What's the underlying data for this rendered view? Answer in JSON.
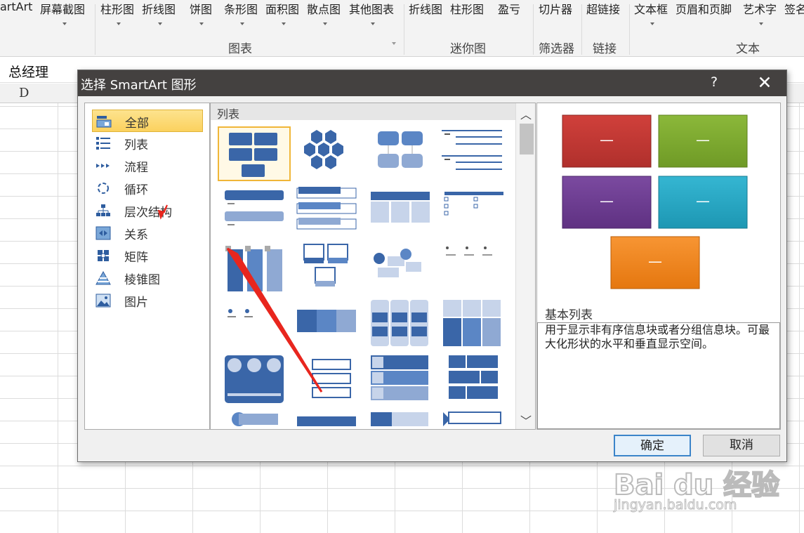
{
  "ribbon": {
    "items": [
      "artArt",
      "屏幕截图",
      "柱形图",
      "折线图",
      "饼图",
      "条形图",
      "面积图",
      "散点图",
      "其他图表",
      "折线图",
      "柱形图",
      "盈亏",
      "切片器",
      "超链接",
      "文本框",
      "页眉和页脚",
      "艺术字",
      "签名"
    ],
    "groups": [
      "图表",
      "迷你图",
      "筛选器",
      "链接",
      "文本"
    ]
  },
  "formula_bar": {
    "cell_content": "总经理"
  },
  "sheet": {
    "column_header": "D"
  },
  "dialog": {
    "title": "选择 SmartArt 图形",
    "help": "?",
    "close": "✕",
    "categories": [
      {
        "label": "全部",
        "icon": "all-icon",
        "selected": true
      },
      {
        "label": "列表",
        "icon": "list-icon"
      },
      {
        "label": "流程",
        "icon": "process-icon"
      },
      {
        "label": "循环",
        "icon": "cycle-icon"
      },
      {
        "label": "层次结构",
        "icon": "hierarchy-icon"
      },
      {
        "label": "关系",
        "icon": "relationship-icon"
      },
      {
        "label": "矩阵",
        "icon": "matrix-icon"
      },
      {
        "label": "棱锥图",
        "icon": "pyramid-icon"
      },
      {
        "label": "图片",
        "icon": "picture-icon"
      }
    ],
    "gallery_title": "列表",
    "scroll_up": "︿",
    "scroll_down": "﹀",
    "preview": {
      "name": "基本列表",
      "description": "用于显示非有序信息块或者分组信息块。可最大化形状的水平和垂直显示空间。",
      "box_colors": [
        "#c0312d",
        "#7ea82e",
        "#6f3d93",
        "#26a8c4",
        "#f08319"
      ],
      "box_label": "—"
    },
    "ok_label": "确定",
    "cancel_label": "取消"
  },
  "watermark": {
    "logo": "Bai du 经验",
    "url": "jingyan.baidu.com"
  },
  "colors": {
    "accent": "#2e5d9f",
    "selection": "#fbd15e",
    "annotation": "#e8261e"
  }
}
